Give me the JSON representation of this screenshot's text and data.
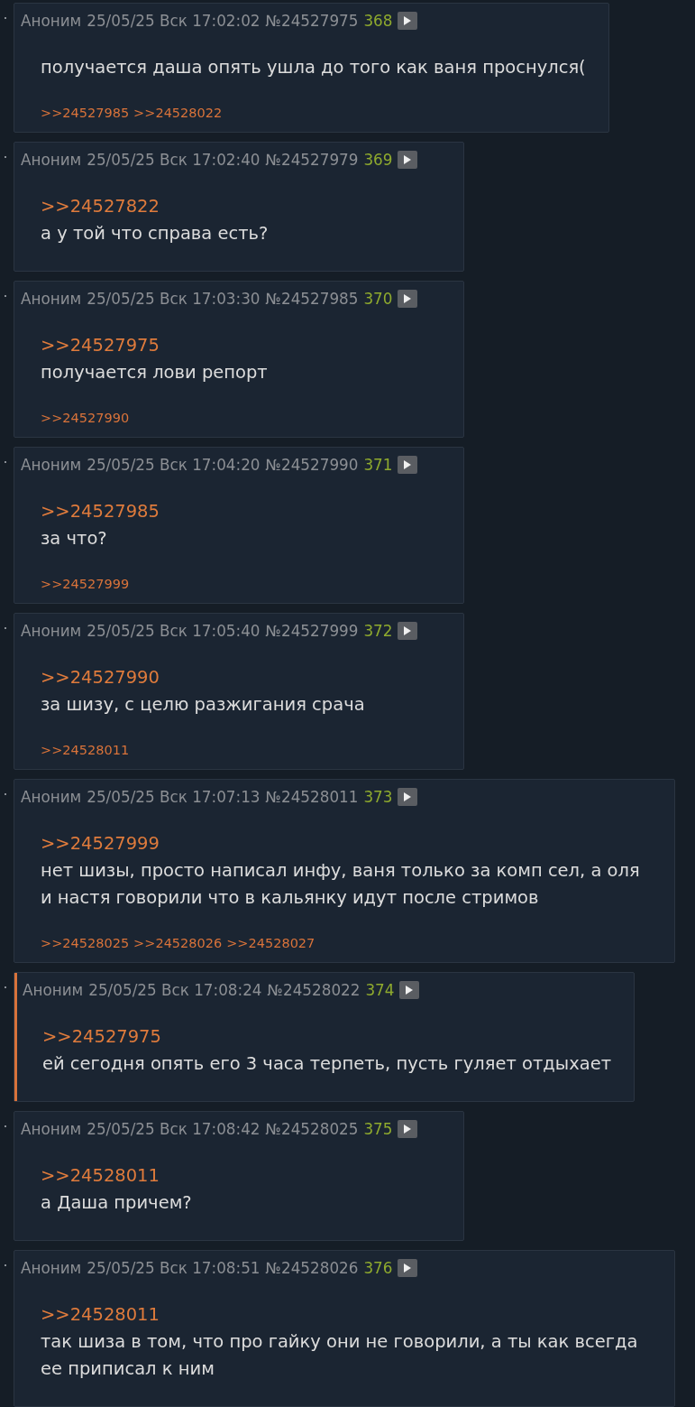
{
  "posts": [
    {
      "author": "Аноним",
      "date": "25/05/25 Вск 17:02:02",
      "number": "№24527975",
      "count": "368",
      "highlighted": false,
      "text": "получается даша опять ушла до того как ваня проснулся(",
      "replies": [
        ">>24527985",
        ">>24528022"
      ]
    },
    {
      "author": "Аноним",
      "date": "25/05/25 Вск 17:02:40",
      "number": "№24527979",
      "count": "369",
      "highlighted": false,
      "quote": ">>24527822",
      "text": "а у той что справа есть?"
    },
    {
      "author": "Аноним",
      "date": "25/05/25 Вск 17:03:30",
      "number": "№24527985",
      "count": "370",
      "highlighted": false,
      "quote": ">>24527975",
      "text": "получается лови репорт",
      "replies": [
        ">>24527990"
      ]
    },
    {
      "author": "Аноним",
      "date": "25/05/25 Вск 17:04:20",
      "number": "№24527990",
      "count": "371",
      "highlighted": false,
      "quote": ">>24527985",
      "text": "за что?",
      "replies": [
        ">>24527999"
      ]
    },
    {
      "author": "Аноним",
      "date": "25/05/25 Вск 17:05:40",
      "number": "№24527999",
      "count": "372",
      "highlighted": false,
      "quote": ">>24527990",
      "text": "за шизу, с целю разжигания срача",
      "replies": [
        ">>24528011"
      ]
    },
    {
      "author": "Аноним",
      "date": "25/05/25 Вск 17:07:13",
      "number": "№24528011",
      "count": "373",
      "highlighted": false,
      "quote": ">>24527999",
      "text": "нет шизы, просто написал инфу, ваня только за комп сел, а оля и настя говорили что в кальянку идут после стримов",
      "replies": [
        ">>24528025",
        ">>24528026",
        ">>24528027"
      ]
    },
    {
      "author": "Аноним",
      "date": "25/05/25 Вск 17:08:24",
      "number": "№24528022",
      "count": "374",
      "highlighted": true,
      "quote": ">>24527975",
      "text": "ей сегодня опять его 3 часа терпеть, пусть гуляет отдыхает"
    },
    {
      "author": "Аноним",
      "date": "25/05/25 Вск 17:08:42",
      "number": "№24528025",
      "count": "375",
      "highlighted": false,
      "quote": ">>24528011",
      "text": "а Даша причем?"
    },
    {
      "author": "Аноним",
      "date": "25/05/25 Вск 17:08:51",
      "number": "№24528026",
      "count": "376",
      "highlighted": false,
      "quote": ">>24528011",
      "text": "так шиза в том, что про гайку они не говорили, а ты как всегда ее приписал к ним"
    }
  ]
}
